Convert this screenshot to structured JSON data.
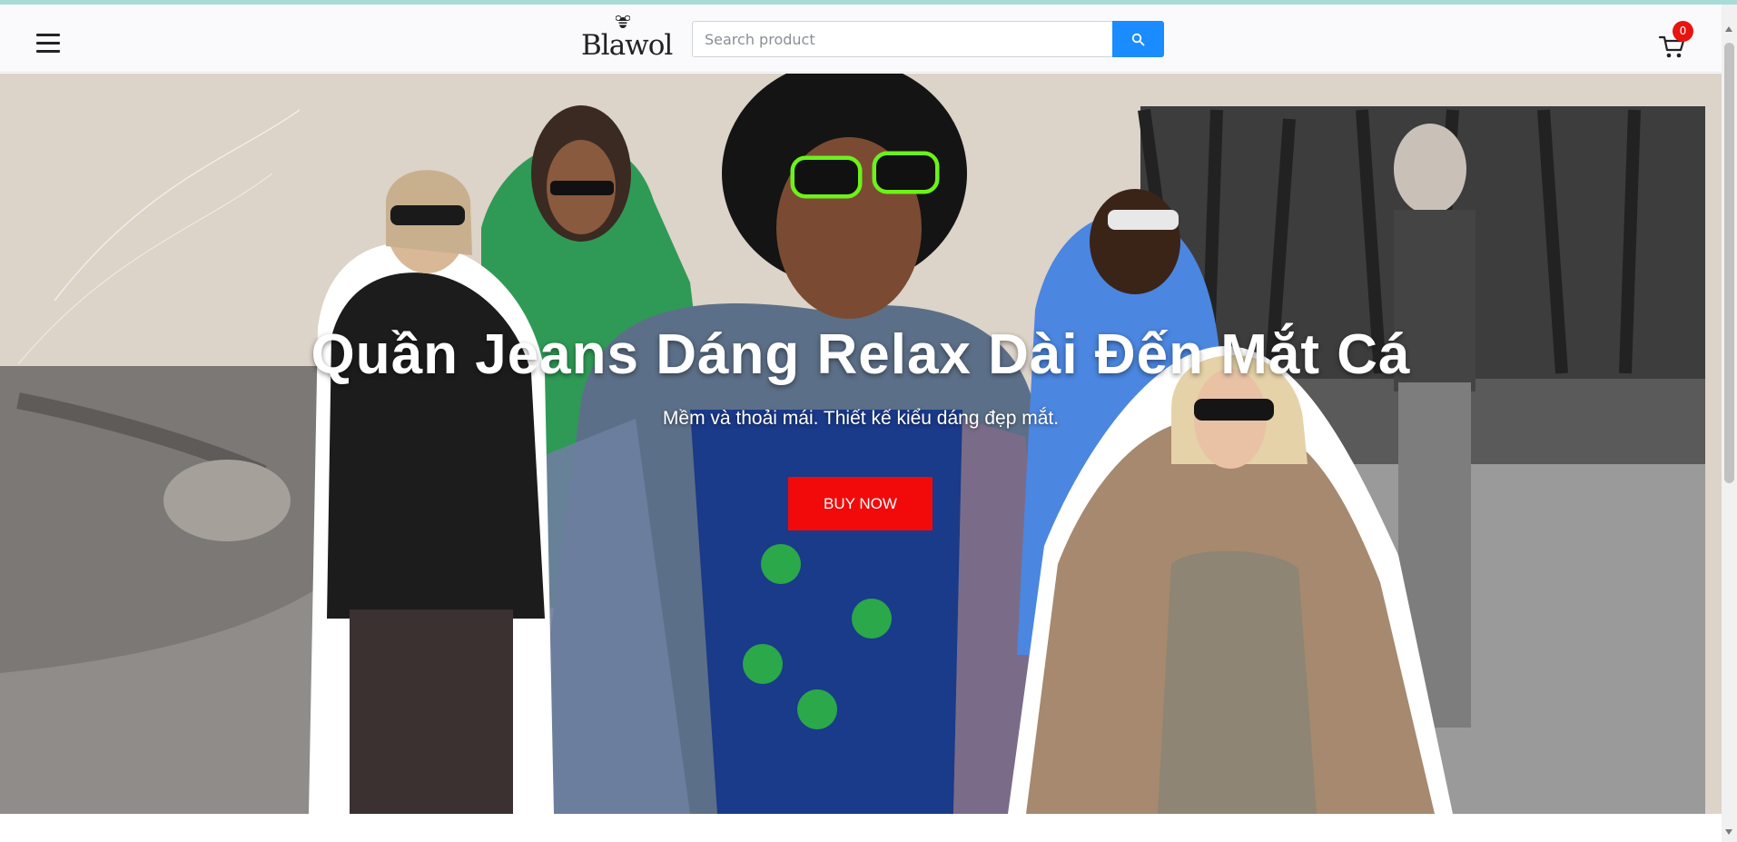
{
  "header": {
    "logo_text": "Blawol",
    "search": {
      "placeholder": "Search product",
      "value": ""
    },
    "cart_count": "0",
    "icons": {
      "menu": "hamburger-menu-icon",
      "search": "search-icon",
      "cart": "shopping-cart-icon",
      "logo_mark": "bee-icon"
    }
  },
  "hero": {
    "title": "Quần Jeans Dáng Relax Dài Đến Mắt Cá",
    "subtitle": "Mềm và thoải mái. Thiết kế kiểu dáng đẹp mắt.",
    "cta_label": "BUY NOW",
    "image_description": ""
  },
  "colors": {
    "accent_blue": "#1a8cff",
    "cta_red": "#f20a0a",
    "badge_red": "#e8140f",
    "top_line": "#a8dcd6"
  }
}
